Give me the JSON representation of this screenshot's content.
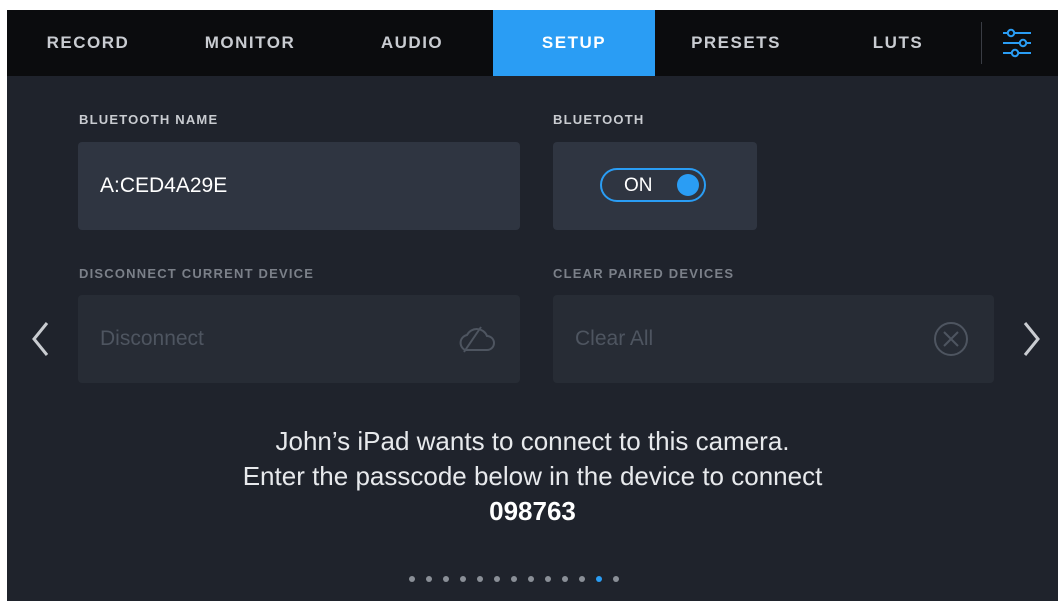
{
  "tabs": [
    {
      "label": "RECORD",
      "active": false
    },
    {
      "label": "MONITOR",
      "active": false
    },
    {
      "label": "AUDIO",
      "active": false
    },
    {
      "label": "SETUP",
      "active": true
    },
    {
      "label": "PRESETS",
      "active": false
    },
    {
      "label": "LUTS",
      "active": false
    }
  ],
  "settings_icon": "sliders-icon",
  "bluetooth_name": {
    "label": "BLUETOOTH NAME",
    "value": "A:CED4A29E"
  },
  "bluetooth": {
    "label": "BLUETOOTH",
    "state": "ON"
  },
  "disconnect": {
    "label": "DISCONNECT CURRENT DEVICE",
    "button": "Disconnect",
    "icon": "cloud-disconnect-icon"
  },
  "clear_paired": {
    "label": "CLEAR PAIRED DEVICES",
    "button": "Clear All",
    "icon": "circle-x-icon"
  },
  "message": {
    "line1": "John’s iPad wants to connect to this camera.",
    "line2": "Enter the passcode below in the device to connect",
    "passcode": "098763"
  },
  "pagination": {
    "total": 13,
    "current": 12
  },
  "colors": {
    "accent": "#2a9df4",
    "background": "#1f232c",
    "topbar": "#0b0c0e"
  }
}
